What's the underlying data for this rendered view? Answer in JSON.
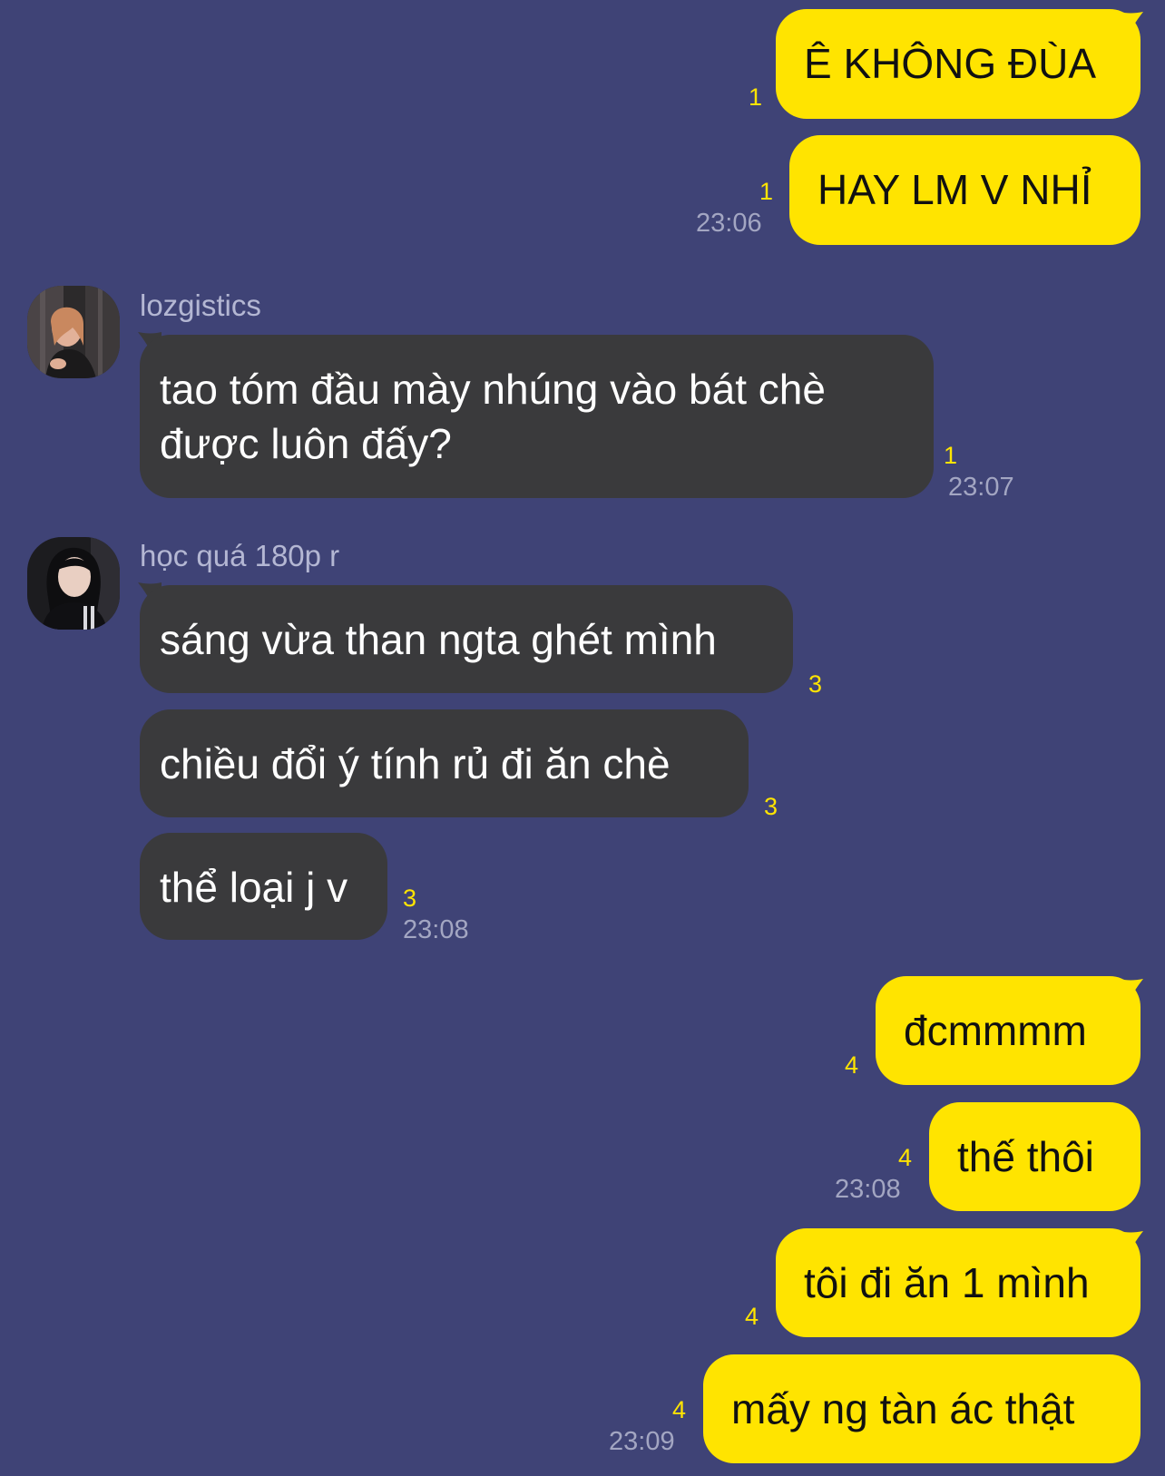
{
  "colors": {
    "background": "#3f4376",
    "own_bubble": "#ffe400",
    "other_bubble": "#3a3a3c",
    "read_count": "#ffe400",
    "timestamp": "#a3a6c2",
    "sender_name": "#b4b7d3"
  },
  "messages": [
    {
      "side": "me",
      "text": "Ê KHÔNG ĐÙA",
      "read_count": "1"
    },
    {
      "side": "me",
      "text": "HAY LM V NHỈ",
      "read_count": "1",
      "time": "23:06"
    },
    {
      "side": "them",
      "sender": "lozgistics",
      "avatar": "avatar-photo-lozgistics",
      "lines": [
        "tao tóm đầu mày nhúng vào bát chè",
        "được luôn đấy?"
      ],
      "read_count": "1",
      "time": "23:07"
    },
    {
      "side": "them",
      "sender": "học quá 180p r",
      "avatar": "avatar-photo-hoc-qua",
      "text": "sáng vừa than ngta ghét mình",
      "read_count": "3"
    },
    {
      "side": "them",
      "text": "chiều đổi ý tính rủ đi ăn chè",
      "read_count": "3"
    },
    {
      "side": "them",
      "text": "thể loại j v",
      "read_count": "3",
      "time": "23:08"
    },
    {
      "side": "me",
      "text": "đcmmmm",
      "read_count": "4"
    },
    {
      "side": "me",
      "text": "thế thôi",
      "read_count": "4",
      "time": "23:08"
    },
    {
      "side": "me",
      "text": "tôi đi ăn 1 mình",
      "read_count": "4"
    },
    {
      "side": "me",
      "text": "mấy ng tàn ác thật",
      "read_count": "4",
      "time": "23:09"
    }
  ]
}
